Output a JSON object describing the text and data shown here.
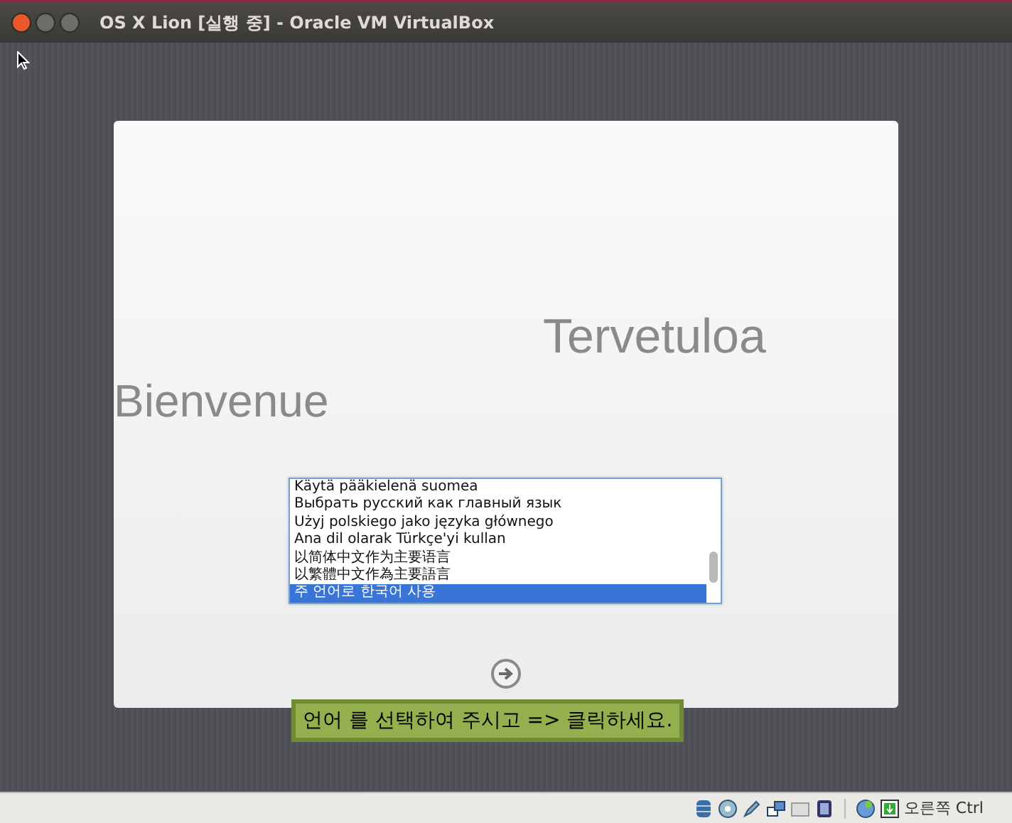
{
  "window": {
    "title": "OS X Lion [실행 중] - Oracle VM VirtualBox"
  },
  "welcome_words": [
    "Tervetuloa",
    "Bienvenue"
  ],
  "languages": [
    {
      "label": "Käytä pääkielenä suomea",
      "selected": false
    },
    {
      "label": "Выбрать русский как главный язык",
      "selected": false
    },
    {
      "label": "Użyj polskiego jako języka głównego",
      "selected": false
    },
    {
      "label": "Ana dil olarak Türkçe'yi kullan",
      "selected": false
    },
    {
      "label": "以简体中文作为主要语言",
      "selected": false
    },
    {
      "label": "以繁體中文作為主要語言",
      "selected": false
    },
    {
      "label": "주 언어로 한국어 사용",
      "selected": true
    }
  ],
  "hint": "언어 를 선택하여 주시고 => 클릭하세요.",
  "status_bar": {
    "host_key": "오른쪽 Ctrl"
  }
}
